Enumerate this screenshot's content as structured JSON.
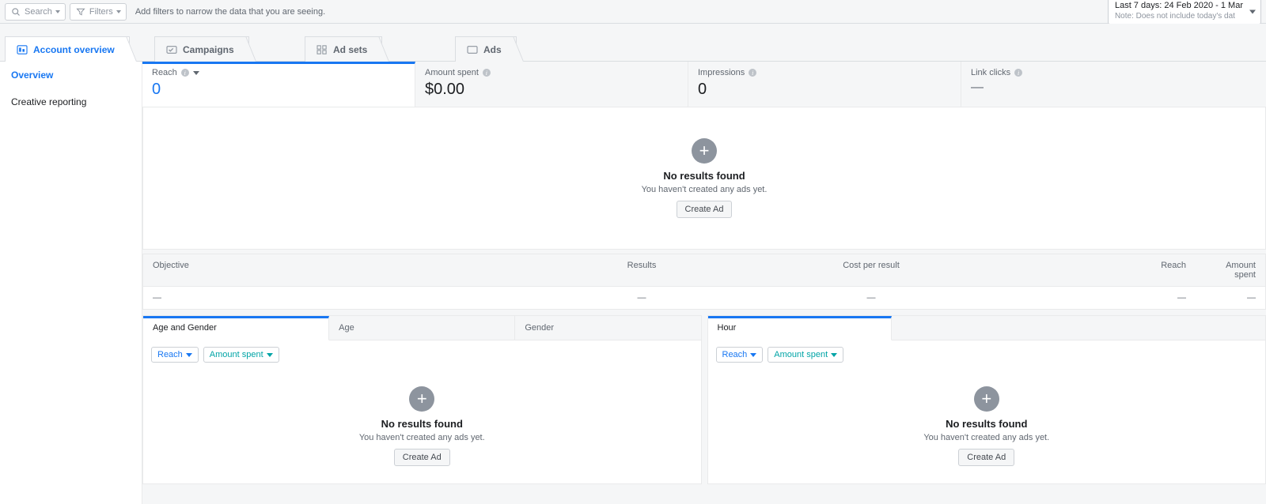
{
  "toolbar": {
    "search_label": "Search",
    "filters_label": "Filters",
    "hint": "Add filters to narrow the data that you are seeing.",
    "date_line1": "Last 7 days: 24 Feb 2020 - 1 Mar",
    "date_line2": "Note: Does not include today's dat"
  },
  "tabs": {
    "account_overview": "Account overview",
    "campaigns": "Campaigns",
    "adsets": "Ad sets",
    "ads": "Ads"
  },
  "sidebar": {
    "overview": "Overview",
    "creative_reporting": "Creative reporting"
  },
  "metrics": {
    "reach_label": "Reach",
    "reach_value": "0",
    "spent_label": "Amount spent",
    "spent_value": "$0.00",
    "impressions_label": "Impressions",
    "impressions_value": "0",
    "clicks_label": "Link clicks",
    "clicks_value": "—"
  },
  "empty": {
    "title": "No results found",
    "sub": "You haven't created any ads yet.",
    "button": "Create Ad"
  },
  "table": {
    "head": {
      "objective": "Objective",
      "results": "Results",
      "cost": "Cost per result",
      "reach": "Reach",
      "spent": "Amount spent"
    },
    "row": {
      "objective": "—",
      "results": "—",
      "cost": "—",
      "reach": "—",
      "spent": "—"
    }
  },
  "panels": {
    "demo": {
      "tab1": "Age and Gender",
      "tab2": "Age",
      "tab3": "Gender"
    },
    "hour": {
      "tab1": "Hour",
      "tab2": ""
    },
    "pill_reach": "Reach",
    "pill_amount": "Amount spent"
  }
}
